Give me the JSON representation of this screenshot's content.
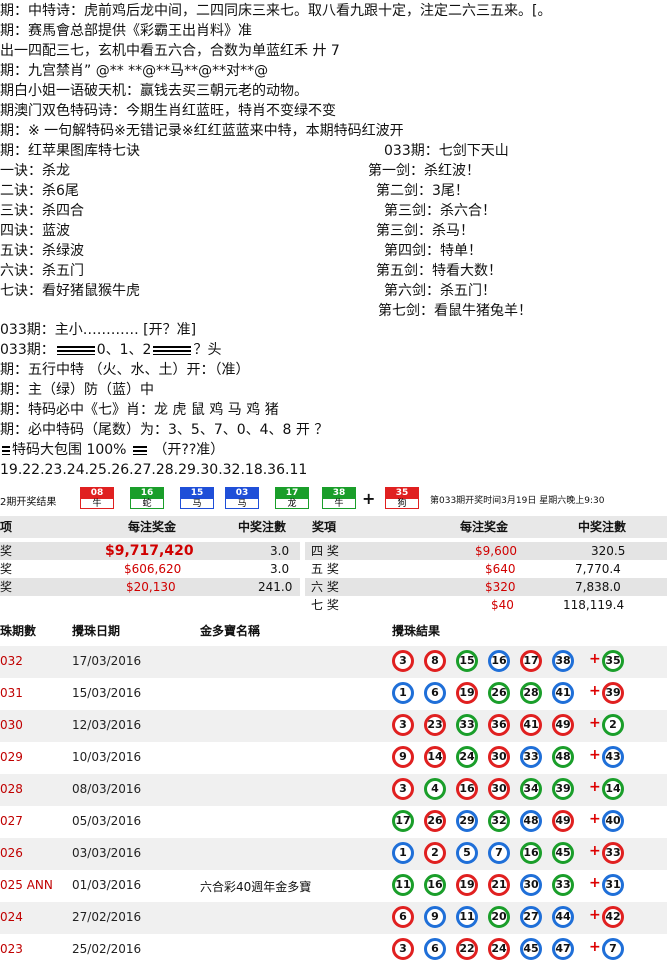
{
  "prediction_lines": [
    "期：中特诗：虎前鸡后龙中间，二四同床三来七。取八看九跟十定，注定二六三五来。[。",
    "期：赛馬會总部提供《彩霸王出肖料》准",
    "出一四配三七，玄机中看五六合，合数为单蓝红禾    廾  7",
    "期：九宫禁肖”  @** **@**马**@**对**@",
    "期白小姐一语破天机：赢钱去买三朝元老的动物。",
    "期澳门双色特码诗：今期生肖红蓝旺，特肖不变绿不变",
    "期：※ 一句解特码※无错记录※红红蓝蓝来中特，本期特码红波开",
    "期：红苹果图库特七诀"
  ],
  "seven_jue": [
    "一诀：杀龙",
    "二诀：杀6尾",
    "三诀：杀四合",
    "四诀：蓝波",
    "五诀：杀绿波",
    "六诀：杀五门",
    "七诀：看好猪鼠猴牛虎"
  ],
  "seven_jian_title": "033期：七剑下天山",
  "seven_jian": [
    "第一剑：杀红波！",
    "第二剑：3尾！",
    "第三剑：杀六合！",
    "第三剑：杀马！",
    "第四剑：特单！",
    "第五剑：特看大数！",
    "第六剑：杀五门！",
    "第七剑：看鼠牛猪兔羊！"
  ],
  "more_lines": {
    "l1": "033期：主小………… [开？准]",
    "l2_pre": "033期：",
    "l2_mid": "0、1、2",
    "l2_post": "？头",
    "l3": "期：五行中特   （火、水、土）开：（准）",
    "l4": "期：主（绿）防（蓝）中",
    "l5": "期：特码必中《七》肖：龙 虎 鼠 鸡 马 鸡 猪",
    "l6": "期：必中特码（尾数）为：3、5、7、0、4、8  开 ？",
    "l7_pre": "特码大包围 100%",
    "l7_post": "（开??准）",
    "l8": "19.22.23.24.25.26.27.28.29.30.32.18.36.11"
  },
  "result_strip": {
    "label": "2期开奖结果",
    "balls": [
      {
        "num": "08",
        "zodiac": "牛",
        "color": "#e02020"
      },
      {
        "num": "16",
        "zodiac": "蛇",
        "color": "#1a9e2a"
      },
      {
        "num": "15",
        "zodiac": "马",
        "color": "#1f4fd8"
      },
      {
        "num": "03",
        "zodiac": "马",
        "color": "#1f4fd8"
      },
      {
        "num": "17",
        "zodiac": "龙",
        "color": "#1a9e2a"
      },
      {
        "num": "38",
        "zodiac": "牛",
        "color": "#1a9e2a"
      },
      {
        "num": "35",
        "zodiac": "狗",
        "color": "#e02020"
      }
    ],
    "plus": "+",
    "info": "第033期开奖时间3月19日 星期六晚上9:30"
  },
  "prize_table": {
    "headers": [
      "项",
      "每注奖金",
      "中奖注數",
      "奖項",
      "每注奖金",
      "中奖注數"
    ],
    "left": [
      {
        "name": "奖",
        "amount": "$9,717,420",
        "count": "3.0"
      },
      {
        "name": "奖",
        "amount": "$606,620",
        "count": "3.0"
      },
      {
        "name": "奖",
        "amount": "$20,130",
        "count": "241.0"
      }
    ],
    "right": [
      {
        "name": "四 奖",
        "amount": "$9,600",
        "count": "320.5"
      },
      {
        "name": "五 奖",
        "amount": "$640",
        "count": "7,770.4"
      },
      {
        "name": "六 奖",
        "amount": "$320",
        "count": "7,838.0"
      },
      {
        "name": "七 奖",
        "amount": "$40",
        "count": "118,119.4"
      }
    ]
  },
  "draw_headers": {
    "no": "珠期數",
    "date": "攪珠日期",
    "name": "金多寶名稱",
    "result": "攪珠結果"
  },
  "draws": [
    {
      "no": "032",
      "date": "17/03/2016",
      "name": "",
      "balls": [
        "3",
        "8",
        "15",
        "16",
        "17",
        "38"
      ],
      "special": "35"
    },
    {
      "no": "031",
      "date": "15/03/2016",
      "name": "",
      "balls": [
        "1",
        "6",
        "19",
        "26",
        "28",
        "41"
      ],
      "special": "39"
    },
    {
      "no": "030",
      "date": "12/03/2016",
      "name": "",
      "balls": [
        "3",
        "23",
        "33",
        "36",
        "41",
        "49"
      ],
      "special": "2"
    },
    {
      "no": "029",
      "date": "10/03/2016",
      "name": "",
      "balls": [
        "9",
        "14",
        "24",
        "30",
        "33",
        "48"
      ],
      "special": "43"
    },
    {
      "no": "028",
      "date": "08/03/2016",
      "name": "",
      "balls": [
        "3",
        "4",
        "16",
        "30",
        "34",
        "39"
      ],
      "special": "14"
    },
    {
      "no": "027",
      "date": "05/03/2016",
      "name": "",
      "balls": [
        "17",
        "26",
        "29",
        "32",
        "48",
        "49"
      ],
      "special": "40"
    },
    {
      "no": "026",
      "date": "03/03/2016",
      "name": "",
      "balls": [
        "1",
        "2",
        "5",
        "7",
        "16",
        "45"
      ],
      "special": "33"
    },
    {
      "no": "025 ANN",
      "date": "01/03/2016",
      "name": "六合彩40週年金多寶",
      "balls": [
        "11",
        "16",
        "19",
        "21",
        "30",
        "33"
      ],
      "special": "31"
    },
    {
      "no": "024",
      "date": "27/02/2016",
      "name": "",
      "balls": [
        "6",
        "9",
        "11",
        "20",
        "27",
        "44"
      ],
      "special": "42"
    },
    {
      "no": "023",
      "date": "25/02/2016",
      "name": "",
      "balls": [
        "3",
        "6",
        "22",
        "24",
        "45",
        "47"
      ],
      "special": "7"
    }
  ],
  "plus_sign": "+",
  "colors": {
    "red": "#e02020",
    "blue": "#1f6fd8",
    "green": "#1a9e2a",
    "accent_red": "#d00000"
  }
}
